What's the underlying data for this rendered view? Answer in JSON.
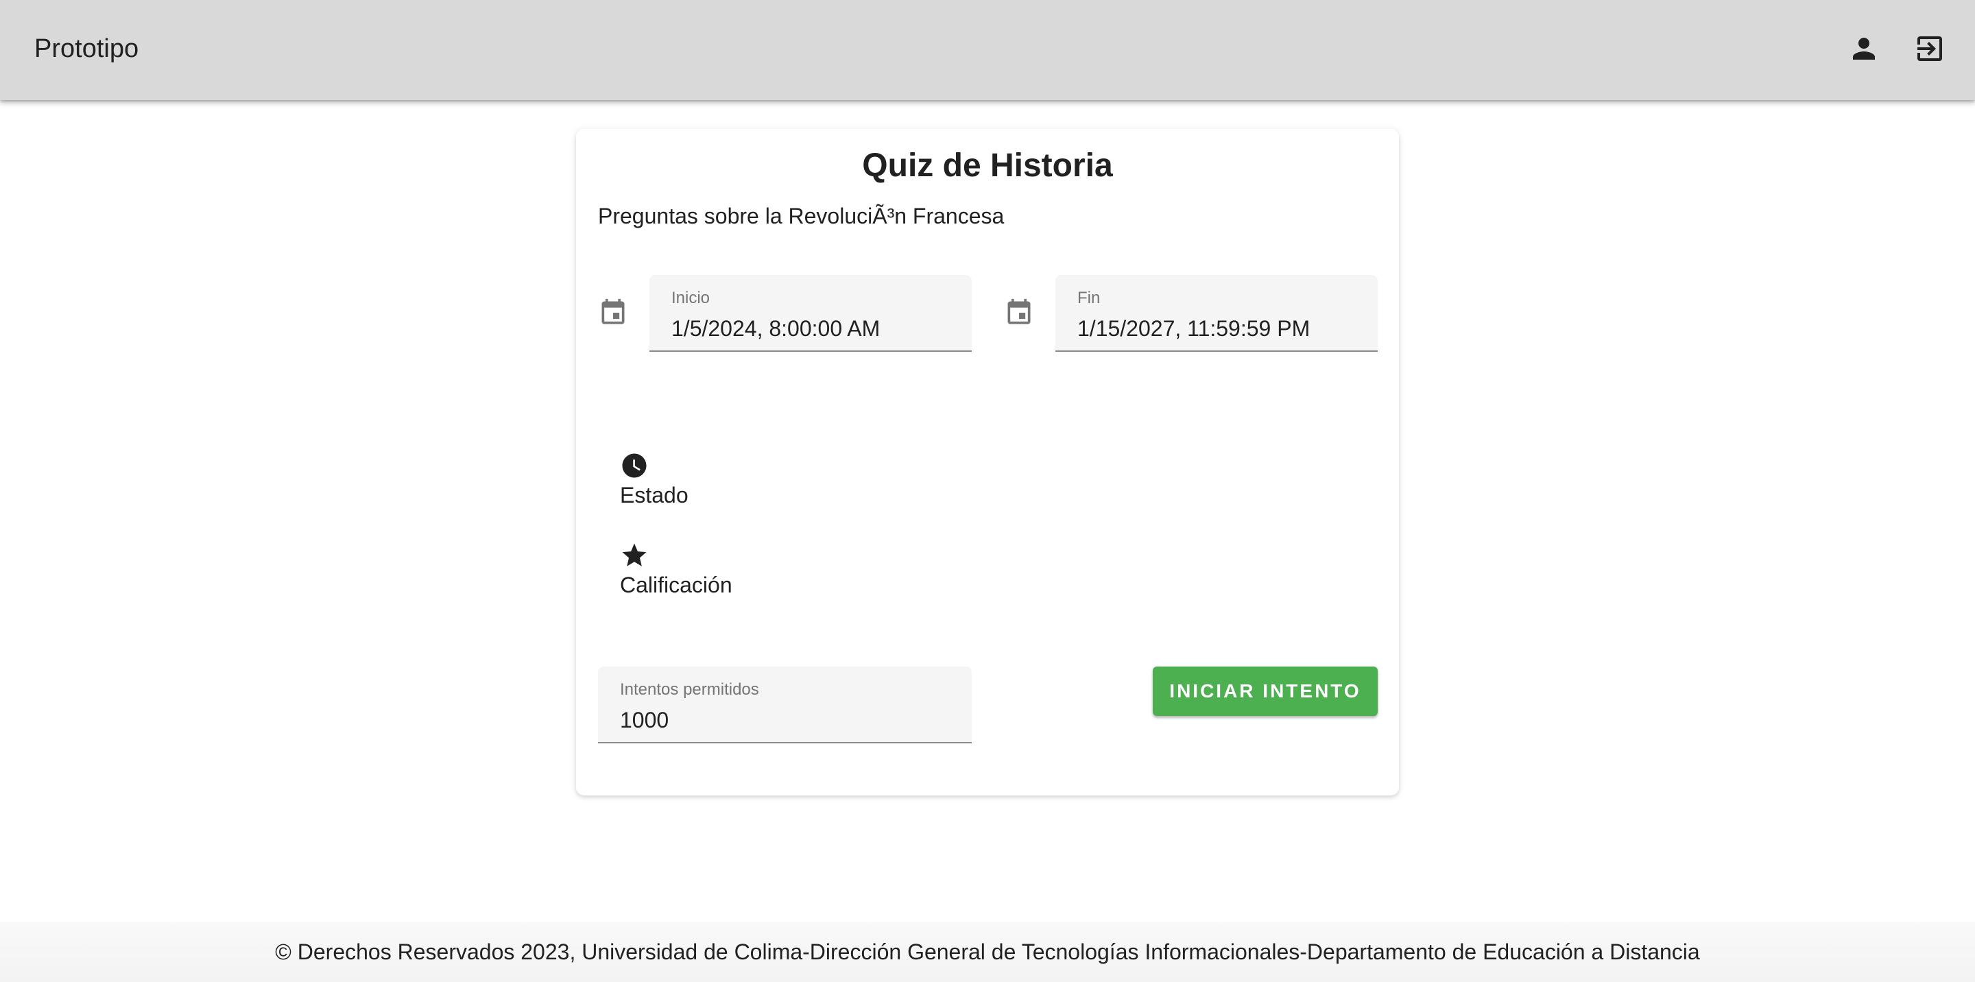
{
  "appbar": {
    "title": "Prototipo",
    "icons": [
      "account-icon",
      "logout-icon"
    ]
  },
  "quiz": {
    "title": "Quiz de Historia",
    "description": "Preguntas sobre la RevoluciÃ³n Francesa",
    "start": {
      "label": "Inicio",
      "value": "1/5/2024, 8:00:00 AM"
    },
    "end": {
      "label": "Fin",
      "value": "1/15/2027, 11:59:59 PM"
    },
    "status": {
      "label": "Estado",
      "icon": "clock-icon"
    },
    "grade": {
      "label": "Calificación",
      "icon": "star-icon"
    },
    "attempts": {
      "label": "Intentos permitidos",
      "value": "1000"
    },
    "start_button_label": "INICIAR INTENTO"
  },
  "footer": {
    "text": "© Derechos Reservados 2023, Universidad de Colima-Dirección General de Tecnologías Informacionales-Departamento de Educación a Distancia"
  },
  "colors": {
    "appbar_bg": "#d9d9d9",
    "button_bg": "#4caf50",
    "field_bg": "#f5f5f5"
  }
}
